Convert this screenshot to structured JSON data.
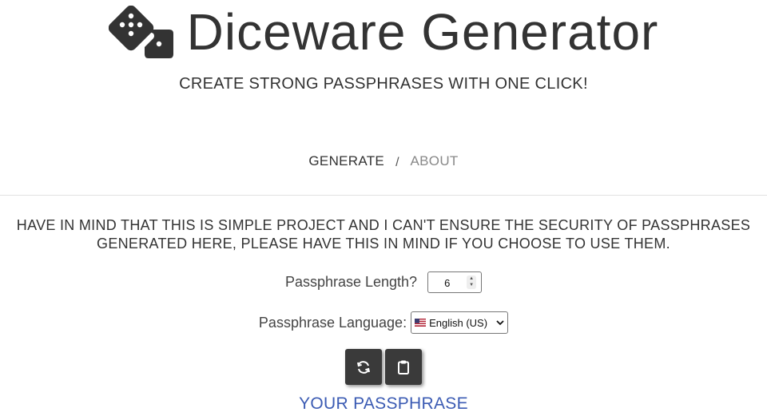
{
  "header": {
    "title": "Diceware Generator",
    "subtitle": "CREATE STRONG PASSPHRASES WITH ONE CLICK!",
    "logo_icon": "dice-icon"
  },
  "nav": {
    "generate_label": "GENERATE",
    "separator": "/",
    "about_label": "ABOUT"
  },
  "main": {
    "warning_line1": "HAVE IN MIND THAT THIS IS SIMPLE PROJECT AND I CAN'T ENSURE THE SECURITY OF PASSPHRASES",
    "warning_line2": "GENERATED HERE, PLEASE HAVE THIS IN MIND IF YOU CHOOSE TO USE THEM.",
    "length_label": "Passphrase Length?",
    "length_value": "6",
    "language_label": "Passphrase Language:",
    "language_selected": "English (US)",
    "language_flag_icon": "us-flag-icon",
    "regenerate_icon": "refresh-icon",
    "copy_icon": "clipboard-icon",
    "result_label": "YOUR PASSPHRASE"
  },
  "colors": {
    "text": "#333333",
    "muted_link": "#888888",
    "button_bg": "#3a3a3a",
    "accent": "#3b5bb3"
  }
}
